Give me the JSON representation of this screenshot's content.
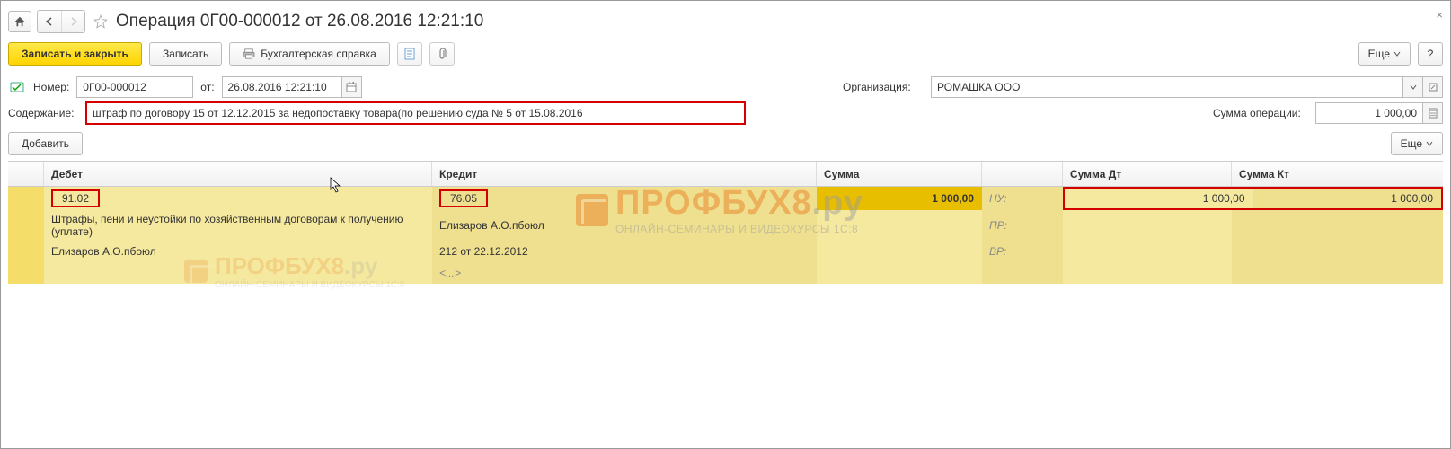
{
  "title": "Операция 0Г00-000012 от 26.08.2016 12:21:10",
  "toolbar": {
    "save_close": "Записать и закрыть",
    "save": "Записать",
    "acc_ref": "Бухгалтерская справка",
    "more": "Еще",
    "help": "?"
  },
  "form": {
    "number_label": "Номер:",
    "number_value": "0Г00-000012",
    "from_label": "от:",
    "date_value": "26.08.2016 12:21:10",
    "org_label": "Организация:",
    "org_value": "РОМАШКА ООО",
    "content_label": "Содержание:",
    "content_value": "штраф по договору 15 от 12.12.2015 за недопоставку товара(по решению суда № 5 от 15.08.2016",
    "sum_label": "Сумма операции:",
    "sum_value": "1 000,00"
  },
  "subbar": {
    "add": "Добавить",
    "more": "Еще"
  },
  "table": {
    "headers": {
      "debit": "Дебет",
      "credit": "Кредит",
      "sum": "Сумма",
      "sum_dt": "Сумма Дт",
      "sum_kt": "Сумма Кт"
    },
    "row1": {
      "debit_acct": "91.02",
      "credit_acct": "76.05",
      "sum": "1 000,00",
      "type_nu": "НУ:",
      "sum_dt": "1 000,00",
      "sum_kt": "1 000,00"
    },
    "row2": {
      "debit_line": "Штрафы, пени и неустойки по хозяйственным договорам к получению (уплате)",
      "credit_line": "Елизаров А.О.пбоюл",
      "type_pr": "ПР:"
    },
    "row3": {
      "debit_line": "Елизаров А.О.пбоюл",
      "credit_line": "212 от 22.12.2012",
      "type_vr": "ВР:"
    },
    "row4": {
      "credit_line": "<...>"
    }
  },
  "watermark": {
    "main": "ПРОФБУХ8",
    "ru": ".ру",
    "sub": "ОНЛАЙН-СЕМИНАРЫ И ВИДЕОКУРСЫ 1С:8"
  }
}
